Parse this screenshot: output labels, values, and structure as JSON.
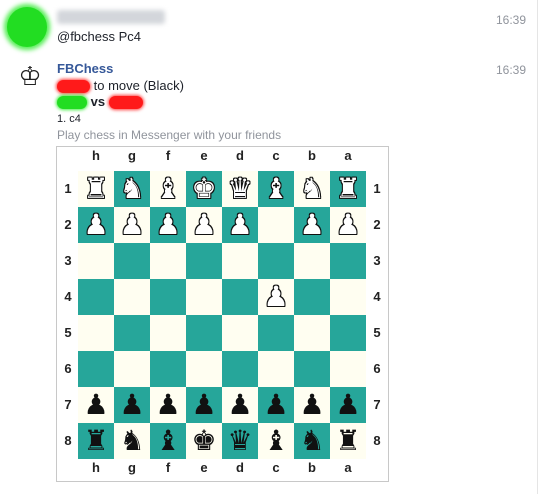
{
  "messages": [
    {
      "timestamp": "16:39",
      "text": "@fbchess Pc4"
    },
    {
      "sender": "FBChess",
      "timestamp": "16:39",
      "to_move": "to move (Black)",
      "vs": "vs",
      "move": "1. c4",
      "subtitle": "Play chess in Messenger with your friends"
    }
  ],
  "board": {
    "files": [
      "h",
      "g",
      "f",
      "e",
      "d",
      "c",
      "b",
      "a"
    ],
    "ranks": [
      "1",
      "2",
      "3",
      "4",
      "5",
      "6",
      "7",
      "8"
    ],
    "colors": {
      "light": "#fffef1",
      "dark": "#26a69a"
    },
    "rows": [
      [
        "wR",
        "wN",
        "wB",
        "wK",
        "wQ",
        "wB",
        "wN",
        "wR"
      ],
      [
        "wP",
        "wP",
        "wP",
        "wP",
        "wP",
        "",
        "wP",
        "wP"
      ],
      [
        "",
        "",
        "",
        "",
        "",
        "",
        "",
        ""
      ],
      [
        "",
        "",
        "",
        "",
        "",
        "wP",
        "",
        ""
      ],
      [
        "",
        "",
        "",
        "",
        "",
        "",
        "",
        ""
      ],
      [
        "",
        "",
        "",
        "",
        "",
        "",
        "",
        ""
      ],
      [
        "bP",
        "bP",
        "bP",
        "bP",
        "bP",
        "bP",
        "bP",
        "bP"
      ],
      [
        "bR",
        "bN",
        "bB",
        "bK",
        "bQ",
        "bB",
        "bN",
        "bR"
      ]
    ]
  }
}
